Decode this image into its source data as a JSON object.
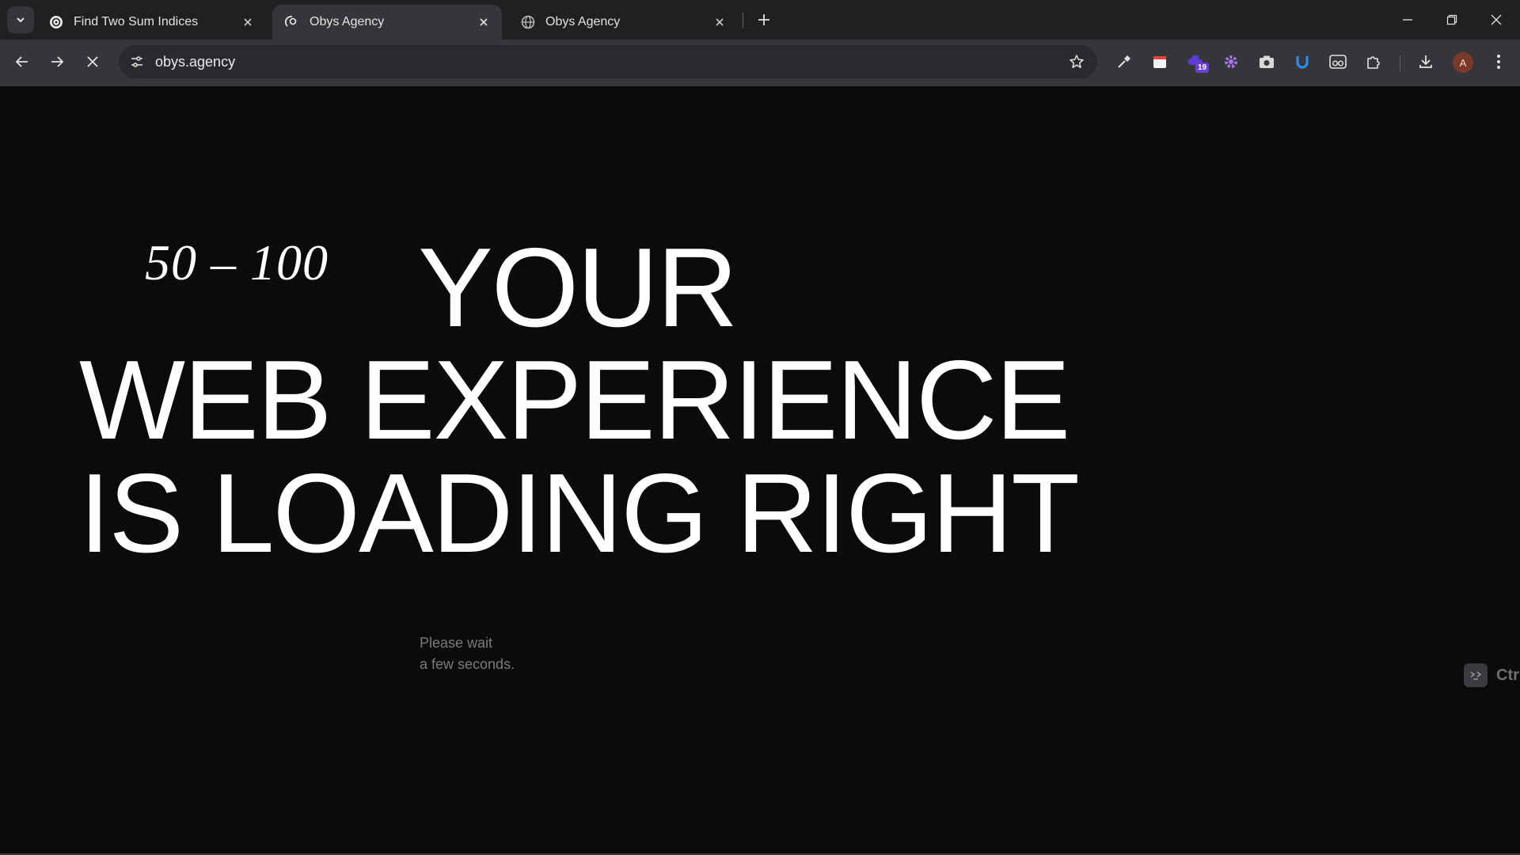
{
  "tabs": [
    {
      "title": "Find Two Sum Indices",
      "favicon": "openai-icon",
      "active": false
    },
    {
      "title": "Obys Agency",
      "favicon": "obys-icon",
      "active": true
    },
    {
      "title": "Obys Agency",
      "favicon": "globe-icon",
      "active": false
    }
  ],
  "omnibox": {
    "url": "obys.agency"
  },
  "extensions": {
    "badge_count": "19"
  },
  "profile": {
    "initial": "A"
  },
  "page": {
    "counter": "50 – 100",
    "headline_line1": "YOUR",
    "headline_line2": "WEB EXPERIENCE",
    "headline_line3": "IS LOADING RIGHT",
    "wait_line1": "Please wait",
    "wait_line2": "a few seconds.",
    "shortcut_label": "Ctr"
  },
  "colors": {
    "background": "#0b0b0b",
    "text": "#ffffff",
    "muted": "#7b7b7b",
    "chrome_bg": "#1f2022",
    "toolbar_bg": "#35363a"
  }
}
